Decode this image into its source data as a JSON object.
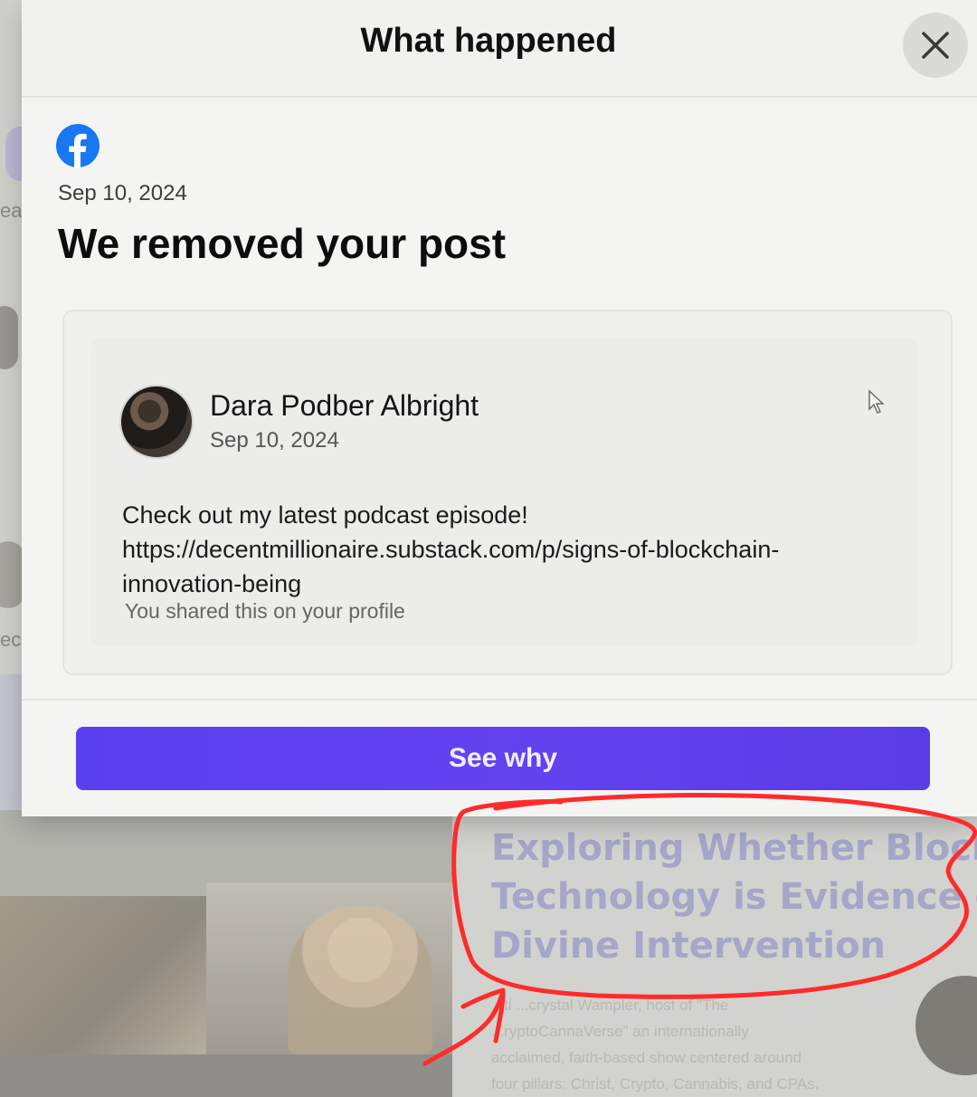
{
  "modal": {
    "title": "What happened",
    "close_icon": "close-icon",
    "logo_icon": "facebook-logo-icon",
    "notice_date": "Sep 10, 2024",
    "heading": "We removed your post",
    "post": {
      "author": "Dara Podber Albright",
      "date": "Sep 10, 2024",
      "text_line1": "Check out my latest podcast episode!",
      "text_line2": "https://decentmillionaire.substack.com/p/signs-of-blockchain-",
      "text_line3": "innovation-being",
      "shared_note": "You shared this on your profile"
    },
    "button_label": "See why",
    "colors": {
      "button": "#5b3ff0",
      "facebook_blue": "#1877f2",
      "annotation": "#ff2b2b"
    }
  },
  "background": {
    "left_snippets": [
      "eat",
      "eck c"
    ],
    "article": {
      "title_lines": [
        "Exploring Whether Blockcha",
        "Technology is Evidence of",
        "Divine Intervention"
      ],
      "body_lines": [
        "...ti ...crystal Wampler, host of \"The",
        "...ryptoCannaVerse\" an internationally",
        "acclaimed, faith-based show centered around",
        "four pillars: Christ, Crypto, Cannabis, and CPAs."
      ]
    }
  }
}
